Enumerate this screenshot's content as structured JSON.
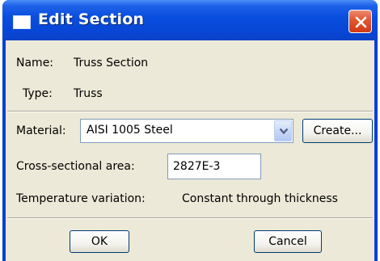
{
  "window": {
    "title": "Edit Section",
    "title_icon": "window-icon",
    "close_icon": "close-icon"
  },
  "info": {
    "name_label": "Name:",
    "name_value": "Truss Section",
    "type_label": "Type:",
    "type_value": "Truss"
  },
  "material": {
    "label": "Material:",
    "selected": "AISI 1005 Steel",
    "create_label": "Create..."
  },
  "area": {
    "label": "Cross-sectional area:",
    "value": "2827E-3"
  },
  "temperature": {
    "label": "Temperature variation:",
    "value": "Constant through thickness"
  },
  "buttons": {
    "ok": "OK",
    "cancel": "Cancel"
  },
  "colors": {
    "title_bar": "#0a4fe0",
    "dialog_bg": "#ece9d8",
    "close_button": "#e1542f"
  }
}
